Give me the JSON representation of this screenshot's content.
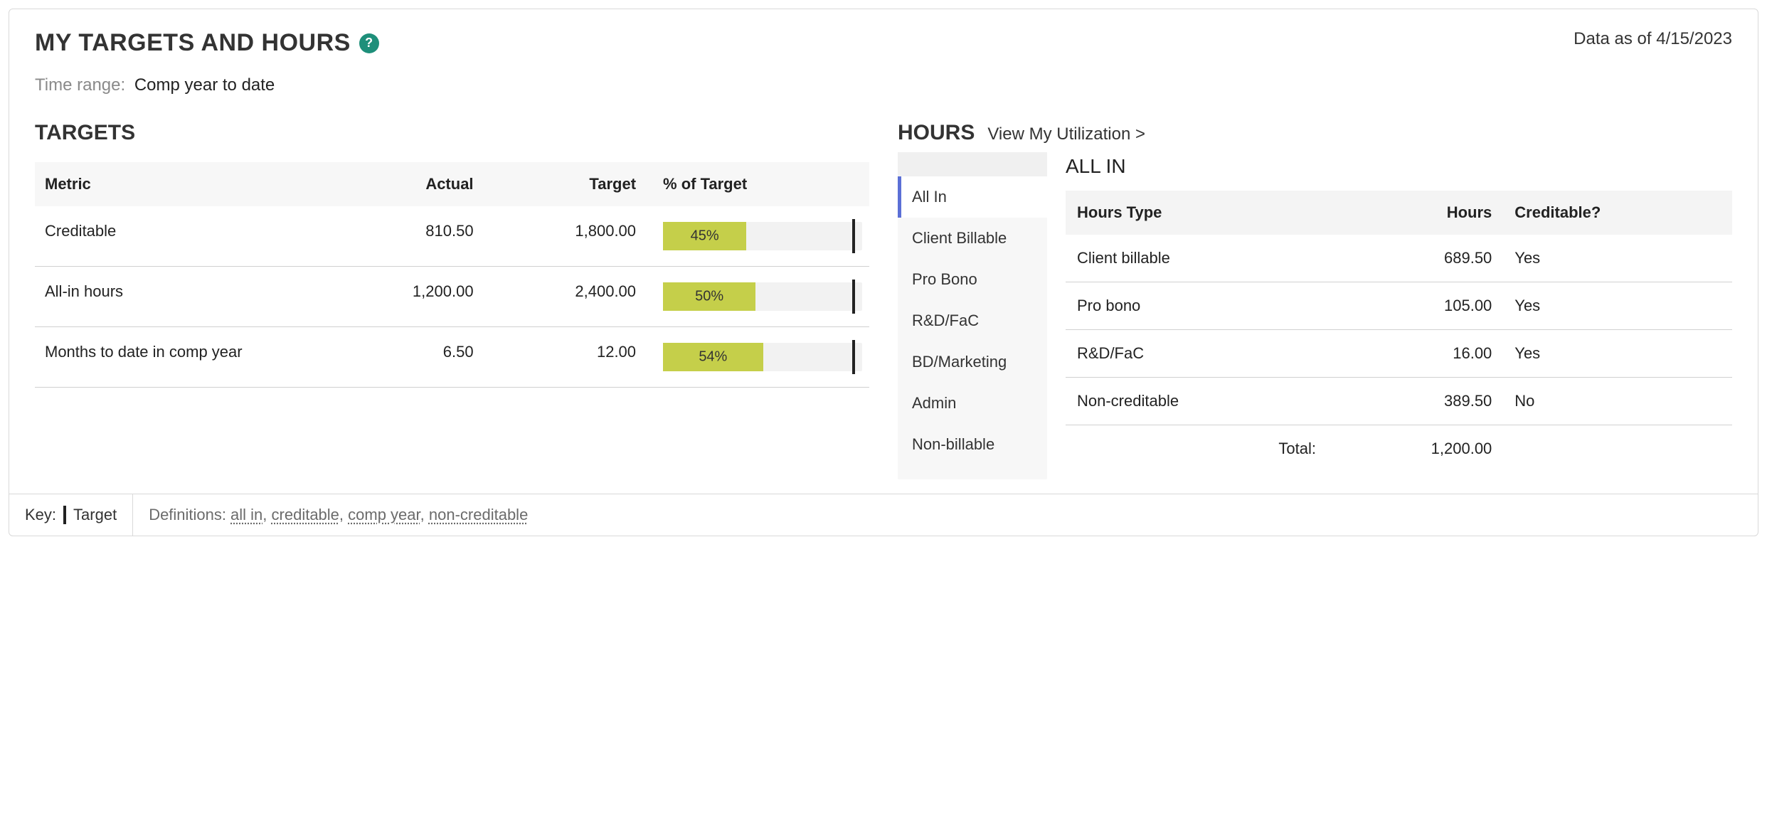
{
  "header": {
    "title": "MY TARGETS AND HOURS",
    "help_symbol": "?",
    "data_asof_prefix": "Data as of ",
    "data_asof_date": "4/15/2023"
  },
  "time_range": {
    "label": "Time range:",
    "value": "Comp year to date"
  },
  "targets": {
    "title": "TARGETS",
    "columns": {
      "metric": "Metric",
      "actual": "Actual",
      "target": "Target",
      "pct": "% of Target"
    },
    "rows": [
      {
        "metric": "Creditable",
        "actual": "810.50",
        "target": "1,800.00",
        "pct_label": "45%",
        "pct_value": 45
      },
      {
        "metric": "All-in hours",
        "actual": "1,200.00",
        "target": "2,400.00",
        "pct_label": "50%",
        "pct_value": 50
      },
      {
        "metric": "Months to date in comp year",
        "actual": "6.50",
        "target": "12.00",
        "pct_label": "54%",
        "pct_value": 54
      }
    ]
  },
  "hours": {
    "title": "HOURS",
    "view_link": "View My Utilization",
    "tabs": [
      "All In",
      "Client Billable",
      "Pro Bono",
      "R&D/FaC",
      "BD/Marketing",
      "Admin",
      "Non-billable"
    ],
    "active_tab_index": 0,
    "detail_title": "ALL IN",
    "columns": {
      "type": "Hours Type",
      "hours": "Hours",
      "creditable": "Creditable?"
    },
    "rows": [
      {
        "type": "Client billable",
        "hours": "689.50",
        "creditable": "Yes"
      },
      {
        "type": "Pro bono",
        "hours": "105.00",
        "creditable": "Yes"
      },
      {
        "type": "R&D/FaC",
        "hours": "16.00",
        "creditable": "Yes"
      },
      {
        "type": "Non-creditable",
        "hours": "389.50",
        "creditable": "No"
      }
    ],
    "total_label": "Total:",
    "total_value": "1,200.00"
  },
  "footer": {
    "key_label": "Key:",
    "key_target": "Target",
    "defs_label": "Definitions:",
    "defs": [
      "all in",
      "creditable",
      "comp year",
      "non-creditable"
    ]
  },
  "chart_data": {
    "type": "bar",
    "title": "% of Target",
    "categories": [
      "Creditable",
      "All-in hours",
      "Months to date in comp year"
    ],
    "values": [
      45,
      50,
      54
    ],
    "target_line": 100,
    "xlabel": "",
    "ylabel": "% of Target",
    "ylim": [
      0,
      100
    ]
  }
}
